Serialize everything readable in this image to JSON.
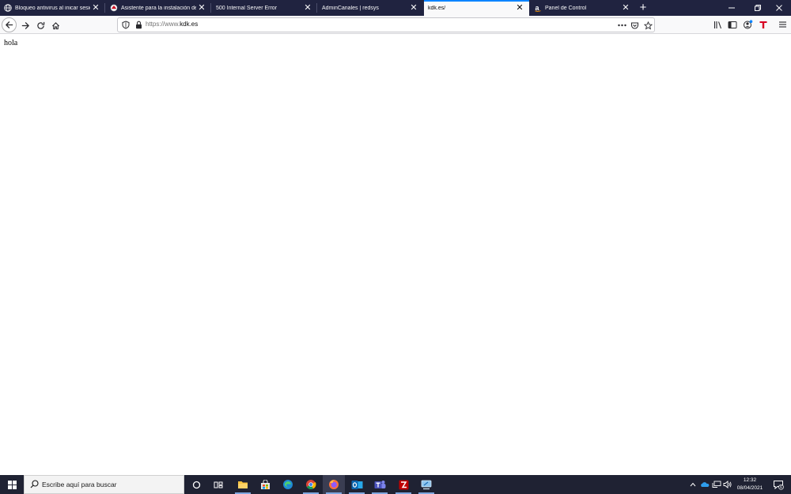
{
  "browser": {
    "tabs": [
      {
        "title": "Bloqueo antivirus al inicar sesión",
        "icon": "globe-icon",
        "active": false
      },
      {
        "title": "Asistente para la instalación de",
        "icon": "redsys-icon",
        "active": false
      },
      {
        "title": "500 Internal Server Error",
        "icon": "",
        "active": false
      },
      {
        "title": "AdminCanales | redsys",
        "icon": "",
        "active": false
      },
      {
        "title": "kdk.es/",
        "icon": "",
        "active": true
      },
      {
        "title": "Panel de Control",
        "icon": "amazon-icon",
        "active": false
      }
    ],
    "new_tab_label": "+",
    "url": {
      "scheme": "https://www.",
      "host": "kdk.es"
    },
    "colors": {
      "tabstrip": "#202340",
      "active_tab": "#f9f9fa",
      "accent": "#0a84ff"
    }
  },
  "page": {
    "body_text": "hola"
  },
  "taskbar": {
    "search_placeholder": "Escribe aquí para buscar",
    "apps": [
      "cortana-icon",
      "task-view-icon",
      "file-explorer-icon",
      "store-icon",
      "edge-icon",
      "chrome-icon",
      "firefox-icon",
      "outlook-icon",
      "teams-icon",
      "filezilla-icon",
      "remote-desktop-icon"
    ],
    "time": "12:32",
    "date": "08/04/2021",
    "notification_count": "6"
  }
}
